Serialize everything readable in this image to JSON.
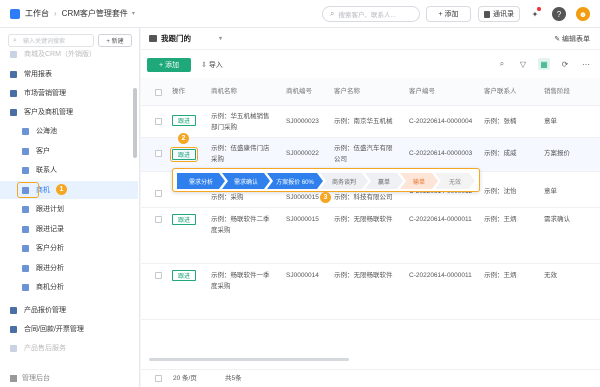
{
  "topbar": {
    "app_name": "工作台",
    "separator": "›",
    "suite_name": "CRM客户管理套件",
    "caret": "▾",
    "search_placeholder": "搜索客户、联系人...",
    "add_label": "+ 添加",
    "contacts_label": "通讯录",
    "help_glyph": "?",
    "bell_glyph": "✦",
    "avatar_glyph": "☻"
  },
  "sidebar": {
    "search_placeholder": "输入关键词搜索",
    "new_label": "+ 新建",
    "items": [
      {
        "label": "商城及CRM（外销版）"
      },
      {
        "label": "常用报表"
      },
      {
        "label": "市场营销管理"
      },
      {
        "label": "客户及商机管理"
      },
      {
        "label": "公海池"
      },
      {
        "label": "客户"
      },
      {
        "label": "联系人"
      },
      {
        "label": "商机"
      },
      {
        "label": "跟进计划"
      },
      {
        "label": "跟进记录"
      },
      {
        "label": "客户分析"
      },
      {
        "label": "跟进分析"
      },
      {
        "label": "商机分析"
      },
      {
        "label": "产品报价管理"
      },
      {
        "label": "合同/回款/开票管理"
      },
      {
        "label": "产品售后服务"
      }
    ],
    "footer_label": "管理后台"
  },
  "annotations": {
    "one": "1",
    "two": "2",
    "three": "3"
  },
  "main": {
    "view_name": "我跟门的",
    "edit_view_label": "编辑表单",
    "new_button": "+ 添加",
    "import_label": "导入",
    "toolbar_icons": {
      "search": "⌕",
      "filter": "▽",
      "chart": "▦",
      "refresh": "⟳",
      "more": "⋯"
    },
    "columns": [
      "操作",
      "商机名称",
      "商机编号",
      "客户名称",
      "客户编号",
      "客户联系人",
      "销售阶段"
    ],
    "rows": [
      {
        "action": "跟进",
        "name": "示例：华五机械销售部门采购",
        "code": "SJ0000023",
        "customer": "示例：南京华五机械",
        "cust_code": "C-20220614-0000004",
        "contact": "示例：张楠",
        "stage": "意单"
      },
      {
        "action": "跟进",
        "name": "示例：伍盛康伟门店采购",
        "code": "SJ0000022",
        "customer": "示例：伍盛汽车有限公司",
        "cust_code": "C-20220614-0000003",
        "contact": "示例：成威",
        "stage": "方案报价"
      },
      {
        "action": "跟进",
        "name": "示例：采购",
        "code": "SJ0000015",
        "customer": "示例：科技有限公司",
        "cust_code": "C-20220614-0000012",
        "contact": "示例：沈怡",
        "stage": "意单"
      },
      {
        "action": "跟进",
        "name": "示例：畅联软件二季度采购",
        "code": "SJ0000015",
        "customer": "示例：无限畅联软件",
        "cust_code": "C-20220614-0000011",
        "contact": "示例：王炳",
        "stage": "需求确认"
      },
      {
        "action": "跟进",
        "name": "示例：畅联软件一季度采购",
        "code": "SJ0000014",
        "customer": "示例：无限畅联软件",
        "cust_code": "C-20220614-0000011",
        "contact": "示例：王炳",
        "stage": "无效"
      }
    ],
    "stages": [
      {
        "label": "需求分析",
        "status": "done"
      },
      {
        "label": "需求确认",
        "status": "done"
      },
      {
        "label": "方案报价 60%",
        "status": "done"
      },
      {
        "label": "商务谈判",
        "status": "todo"
      },
      {
        "label": "赢单",
        "status": "todo"
      },
      {
        "label": "输单",
        "status": "lose"
      },
      {
        "label": "无效",
        "status": "none"
      }
    ],
    "pager": {
      "per_page": "20 条/页",
      "total": "共5条"
    }
  },
  "colors": {
    "primary": "#2e7cf6",
    "green": "#1fa87a",
    "annotation": "#f5a623"
  }
}
